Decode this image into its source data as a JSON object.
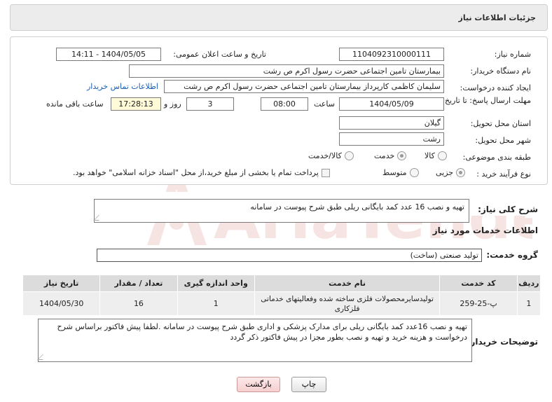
{
  "header": {
    "title": "جزئیات اطلاعات نیاز"
  },
  "form": {
    "need_number_label": "شماره نیاز:",
    "need_number": "1104092310000111",
    "announce_label": "تاریخ و ساعت اعلان عمومی:",
    "announce_value": "1404/05/05 - 14:11",
    "buyer_org_label": "نام دستگاه خریدار:",
    "buyer_org": "بیمارستان  تامین اجتماعی حضرت رسول اکرم ص رشت",
    "creator_label": "ایجاد کننده درخواست:",
    "creator": "سلیمان کاظمی کارپرداز بیمارستان  تامین اجتماعی حضرت رسول اکرم ص رشت",
    "contact_link": "اطلاعات تماس خریدار",
    "deadline_label": "مهلت ارسال پاسخ: تا تاریخ:",
    "deadline_date": "1404/05/09",
    "time_label": "ساعت",
    "deadline_time": "08:00",
    "days_value": "3",
    "days_label": "روز و",
    "remaining_time": "17:28:13",
    "remaining_label": "ساعت باقی مانده",
    "province_label": "استان محل تحویل:",
    "province": "گیلان",
    "city_label": "شهر محل تحویل:",
    "city": "رشت",
    "category_label": "طبقه بندی موضوعی:",
    "category_options": [
      "کالا",
      "خدمت",
      "کالا/خدمت"
    ],
    "category_selected": "خدمت",
    "process_label": "نوع فرآیند خرید :",
    "process_options": [
      "جزیی",
      "متوسط"
    ],
    "process_selected": "جزیی",
    "payment_note": "پرداخت تمام یا بخشی از مبلغ خرید،از محل \"اسناد خزانه اسلامی\" خواهد بود."
  },
  "summary": {
    "label": "شرح کلی نیاز:",
    "text": "تهیه و نصب 16 عدد کمد بایگانی ریلی طبق شرح پیوست در سامانه"
  },
  "services": {
    "section_title": "اطلاعات خدمات مورد نیاز",
    "group_label": "گروه خدمت:",
    "group_value": "تولید صنعتی (ساخت)",
    "columns": [
      "ردیف",
      "کد خدمت",
      "نام خدمت",
      "واحد اندازه گیری",
      "تعداد / مقدار",
      "تاریخ نیاز"
    ],
    "rows": [
      {
        "row": "1",
        "code": "پ-25-259",
        "name": "تولیدسایرمحصولات فلزی ساخته شده وفعالیتهای خدماتی فلزکاری",
        "unit": "1",
        "qty": "16",
        "date": "1404/05/30"
      }
    ]
  },
  "buyer_notes": {
    "label": "توضیحات خریدار:",
    "text": "تهیه و نصب 16عدد کمد بایگانی ریلی برای مدارک پزشکی و اداری طبق شرح پیوست در سامانه .لطفا پیش فاکتور براساس شرح درخواست و هزینه خرید و تهیه و نصب بطور مجزا در پیش فاکتور ذکر گردد"
  },
  "buttons": {
    "print": "چاپ",
    "back": "بازگشت"
  },
  "watermark": {
    "text": "AriaTender.neT"
  },
  "colors": {
    "link": "#1a5fb4",
    "header_bg": "#ececec",
    "back_button": "#f6cfcf",
    "watermark": "#c0392b"
  }
}
